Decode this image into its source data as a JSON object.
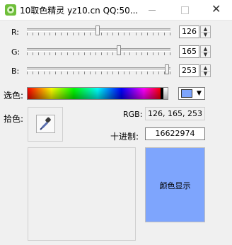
{
  "window": {
    "title": "10取色精灵 yz10.cn QQ:50..."
  },
  "sliders": [
    {
      "label": "R:",
      "value": "126",
      "max": 255
    },
    {
      "label": "G:",
      "value": "165",
      "max": 255
    },
    {
      "label": "B:",
      "value": "253",
      "max": 255
    }
  ],
  "picker": {
    "label": "选色:"
  },
  "eyedropper": {
    "label": "拾色:"
  },
  "rgb": {
    "label": "RGB:",
    "value": "126, 165, 253"
  },
  "decimal": {
    "label": "十进制:",
    "value": "16622974"
  },
  "preview": {
    "label": "颜色显示"
  },
  "colors": {
    "current": "#7ea5fd",
    "accent": "#7ea5fd"
  },
  "icons": {
    "app": "app-icon",
    "eyedropper": "eyedropper-icon",
    "spin_up": "spin-up-icon",
    "spin_down": "spin-down-icon",
    "dropdown": "chevron-down-icon"
  }
}
